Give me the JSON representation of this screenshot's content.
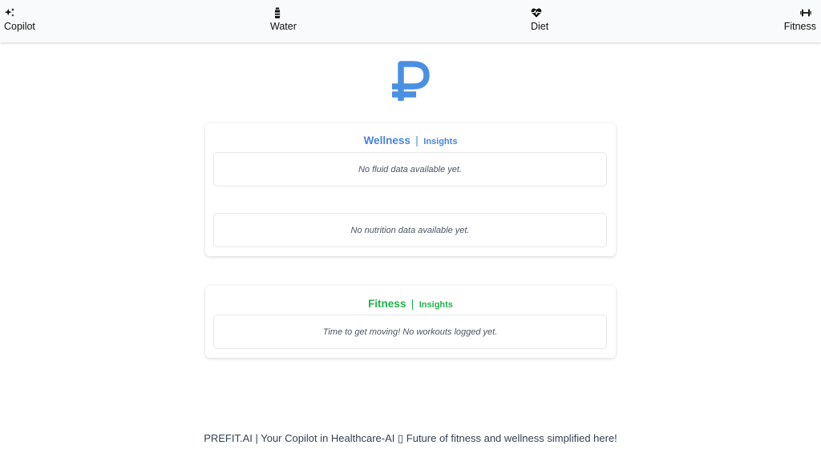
{
  "nav": {
    "items": [
      {
        "label": "Copilot",
        "icon": "sparkles-icon"
      },
      {
        "label": "Water",
        "icon": "water-bottle-icon"
      },
      {
        "label": "Diet",
        "icon": "heart-pulse-icon"
      },
      {
        "label": "Fitness",
        "icon": "dumbbell-icon"
      }
    ]
  },
  "logo": {
    "glyph": "₽",
    "color": "#4a90e2"
  },
  "wellness": {
    "title": "Wellness",
    "separator": "|",
    "subtitle": "Insights",
    "fluid_message": "No fluid data available yet.",
    "nutrition_message": "No nutrition data available yet.",
    "color": "#4a85db"
  },
  "fitness": {
    "title": "Fitness",
    "separator": "|",
    "subtitle": "Insights",
    "workout_message": "Time to get moving! No workouts logged yet.",
    "color": "#22b14c"
  },
  "footer": {
    "text": "PREFIT.AI | Your Copilot in Healthcare-AI ▯ Future of fitness and wellness simplified here!"
  }
}
